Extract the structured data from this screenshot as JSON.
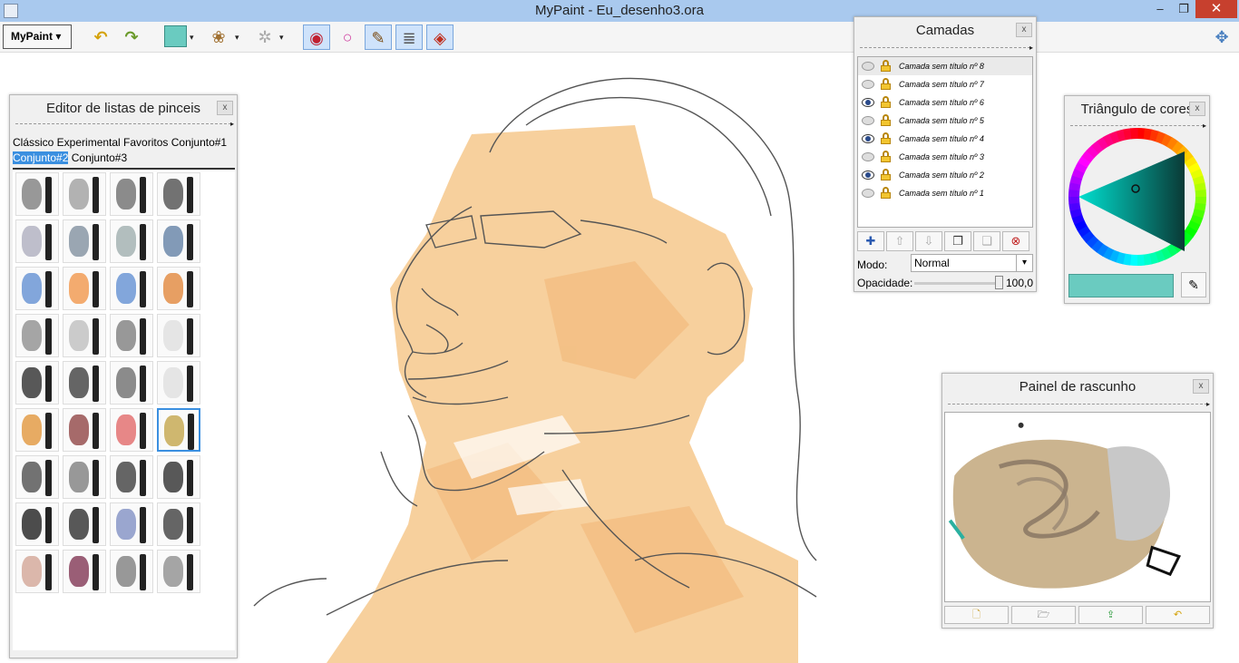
{
  "window": {
    "title": "MyPaint - Eu_desenho3.ora",
    "minimize": "–",
    "maximize": "❐",
    "close": "✕"
  },
  "toolbar": {
    "menu_label": "MyPaint ▾",
    "undo": "↶",
    "redo": "↷",
    "color_value": "#6acbc0",
    "brush_caret": "▾",
    "settings_caret": "▾",
    "gear": "✲",
    "brush_icon": "❀",
    "toggles": [
      "◉",
      "○",
      "✎",
      "≣",
      "◈"
    ],
    "fullscreen": "✥"
  },
  "brush_editor": {
    "title": "Editor de listas de pinceis",
    "close": "x",
    "groups_line1": "Clássico Experimental Favoritos Conjunto#1",
    "group_selected": "Conjunto#2",
    "group_other": "Conjunto#3"
  },
  "layers": {
    "title": "Camadas",
    "close": "x",
    "items": [
      {
        "name": "Camada sem título nº 8",
        "visible": false
      },
      {
        "name": "Camada sem título nº 7",
        "visible": false
      },
      {
        "name": "Camada sem título nº 6",
        "visible": true
      },
      {
        "name": "Camada sem título nº 5",
        "visible": false
      },
      {
        "name": "Camada sem título nº 4",
        "visible": true
      },
      {
        "name": "Camada sem título nº 3",
        "visible": false
      },
      {
        "name": "Camada sem título nº 2",
        "visible": true
      },
      {
        "name": "Camada sem título nº 1",
        "visible": false
      }
    ],
    "buttons": [
      "✚",
      "⇧",
      "⇩",
      "❐",
      "❏",
      "⊗"
    ],
    "mode_label": "Modo:",
    "mode_value": "Normal",
    "mode_dd": "▾",
    "opacity_label": "Opacidade:",
    "opacity_value": "100,0",
    "opacity_fraction": 1.0
  },
  "color_triangle": {
    "title": "Triângulo de cores",
    "close": "x",
    "current_color": "#6acbc0",
    "picker": "✎"
  },
  "scratchpad": {
    "title": "Painel de rascunho",
    "close": "x",
    "buttons": [
      "🗋",
      "🗁",
      "⇪",
      "↶"
    ]
  }
}
